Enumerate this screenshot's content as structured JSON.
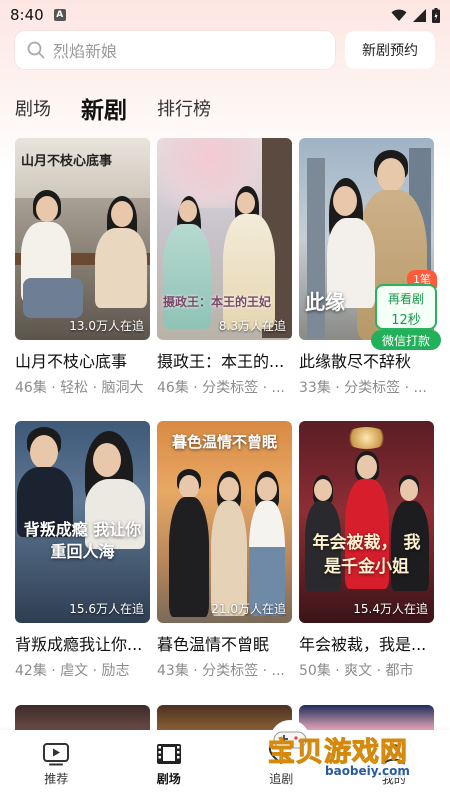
{
  "status_bar": {
    "time": "8:40",
    "a_badge": "A"
  },
  "search": {
    "placeholder": "烈焰新娘",
    "reserve_label": "新剧预约"
  },
  "tabs": [
    {
      "label": "剧场",
      "active": false
    },
    {
      "label": "新剧",
      "active": true
    },
    {
      "label": "排行榜",
      "active": false
    }
  ],
  "dramas": [
    {
      "title": "山月不枝心底事",
      "meta": "46集 · 轻松 · 脑洞大",
      "tracking": "13.0万人在追",
      "poster_text": "山月不枝心底事"
    },
    {
      "title": "摄政王：本王的...",
      "meta": "46集 · 分类标签 · ...",
      "tracking": "8.3万人在追",
      "poster_text": "摄政王：本王的王妃"
    },
    {
      "title": "此缘散尽不辞秋",
      "meta": "33集 · 分类标签 · ...",
      "tracking": "",
      "poster_text": "此缘"
    },
    {
      "title": "背叛成瘾我让你...",
      "meta": "42集 · 虐文 · 励志",
      "tracking": "15.6万人在追",
      "poster_text": "背叛成瘾 我让你重回人海"
    },
    {
      "title": "暮色温情不曾眠",
      "meta": "43集 · 分类标签 · ...",
      "tracking": "21.0万人在追",
      "poster_text": "暮色温情不曾眠"
    },
    {
      "title": "年会被裁，我是...",
      "meta": "50集 · 爽文 · 都市",
      "tracking": "15.4万人在追",
      "poster_text": "年会被裁， 我是千金小姐"
    }
  ],
  "bonus": {
    "badge": "1笔",
    "line1": "再看剧",
    "line2": "12秒",
    "button": "微信打款"
  },
  "bottom_nav": [
    {
      "label": "推荐",
      "icon": "play-icon",
      "active": false
    },
    {
      "label": "剧场",
      "icon": "film-icon",
      "active": true
    },
    {
      "label": "追剧",
      "icon": "heart-icon",
      "active": false
    },
    {
      "label": "我的",
      "icon": "user-icon",
      "active": false
    }
  ],
  "watermark": {
    "main": "宝贝游戏网",
    "sub": "baobeiy.com"
  },
  "colors": {
    "accent_green": "#29b35b",
    "bonus_red": "#ff5a3c",
    "watermark_yellow": "#ffcc2a"
  }
}
